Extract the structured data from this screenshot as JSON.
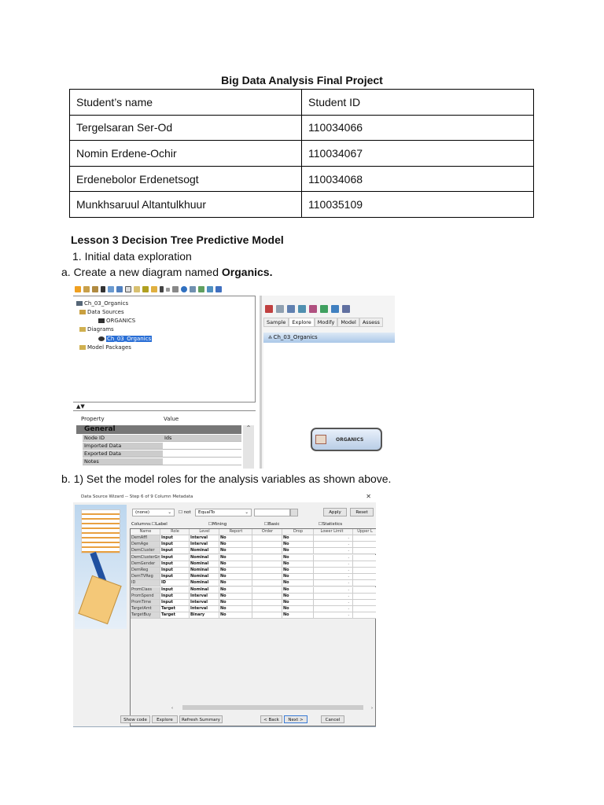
{
  "doc_title": "Big Data Analysis Final Project",
  "students": {
    "headers": [
      "Student’s name",
      "Student ID"
    ],
    "rows": [
      [
        "Tergelsaran Ser-Od",
        "110034066"
      ],
      [
        "Nomin Erdene-Ochir",
        "110034067"
      ],
      [
        "Erdenebolor Erdenetsogt",
        "110034068"
      ],
      [
        "Munkhsaruul Altantulkhuur",
        "110035109"
      ]
    ]
  },
  "lesson_title": "Lesson 3 Decision Tree Predictive Model",
  "step1": "1. Initial data exploration",
  "step_a_prefix": "a.  Create a new diagram named ",
  "step_a_bold": "Organics.",
  "step_b": "b.  1) Set the model roles for the analysis variables as shown above.",
  "screenshot1": {
    "tree": [
      "Ch_03_Organics",
      "Data Sources",
      "ORGANICS",
      "Diagrams",
      "Ch_03_Organics",
      "Model Packages"
    ],
    "prop_headers": [
      "Property",
      "Value"
    ],
    "prop_section": "General",
    "props": [
      [
        "Node ID",
        "Ids"
      ],
      [
        "Imported Data",
        ""
      ],
      [
        "Exported Data",
        ""
      ],
      [
        "Notes",
        ""
      ]
    ],
    "tabs": [
      "Sample",
      "Explore",
      "Modify",
      "Model",
      "Assess"
    ],
    "diagram_title": "Ch_03_Organics",
    "node_label": "ORGANICS"
  },
  "screenshot2": {
    "window_title": "Data Source Wizard -- Step 6 of 9  Column Metadata",
    "filter_col": "(none)",
    "not_label": "not",
    "operator": "EqualTo",
    "apply": "Apply",
    "reset": "Reset",
    "columns_label": "Columns:",
    "checkboxes": [
      "Label",
      "Mining",
      "Basic",
      "Statistics"
    ],
    "headers": [
      "Name",
      "Role",
      "Level",
      "Report",
      "Order",
      "Drop",
      "Lower Limit",
      "Upper L"
    ],
    "rows": [
      [
        "DemAffl",
        "Input",
        "Interval",
        "No",
        "",
        "No",
        "."
      ],
      [
        "DemAge",
        "Input",
        "Interval",
        "No",
        "",
        "No",
        "."
      ],
      [
        "DemCluster",
        "Input",
        "Nominal",
        "No",
        "",
        "No",
        "."
      ],
      [
        "DemClusterGroup",
        "Input",
        "Nominal",
        "No",
        "",
        "No",
        "."
      ],
      [
        "DemGender",
        "Input",
        "Nominal",
        "No",
        "",
        "No",
        "."
      ],
      [
        "DemReg",
        "Input",
        "Nominal",
        "No",
        "",
        "No",
        "."
      ],
      [
        "DemTVReg",
        "Input",
        "Nominal",
        "No",
        "",
        "No",
        "."
      ],
      [
        "ID",
        "ID",
        "Nominal",
        "No",
        "",
        "No",
        "."
      ],
      [
        "PromClass",
        "Input",
        "Nominal",
        "No",
        "",
        "No",
        "."
      ],
      [
        "PromSpend",
        "Input",
        "Interval",
        "No",
        "",
        "No",
        "."
      ],
      [
        "PromTime",
        "Input",
        "Interval",
        "No",
        "",
        "No",
        "."
      ],
      [
        "TargetAmt",
        "Target",
        "Interval",
        "No",
        "",
        "No",
        "."
      ],
      [
        "TargetBuy",
        "Target",
        "Binary",
        "No",
        "",
        "No",
        "."
      ]
    ],
    "buttons": [
      "Show code",
      "Explore",
      "Refresh Summary",
      "< Back",
      "Next >",
      "Cancel"
    ]
  }
}
